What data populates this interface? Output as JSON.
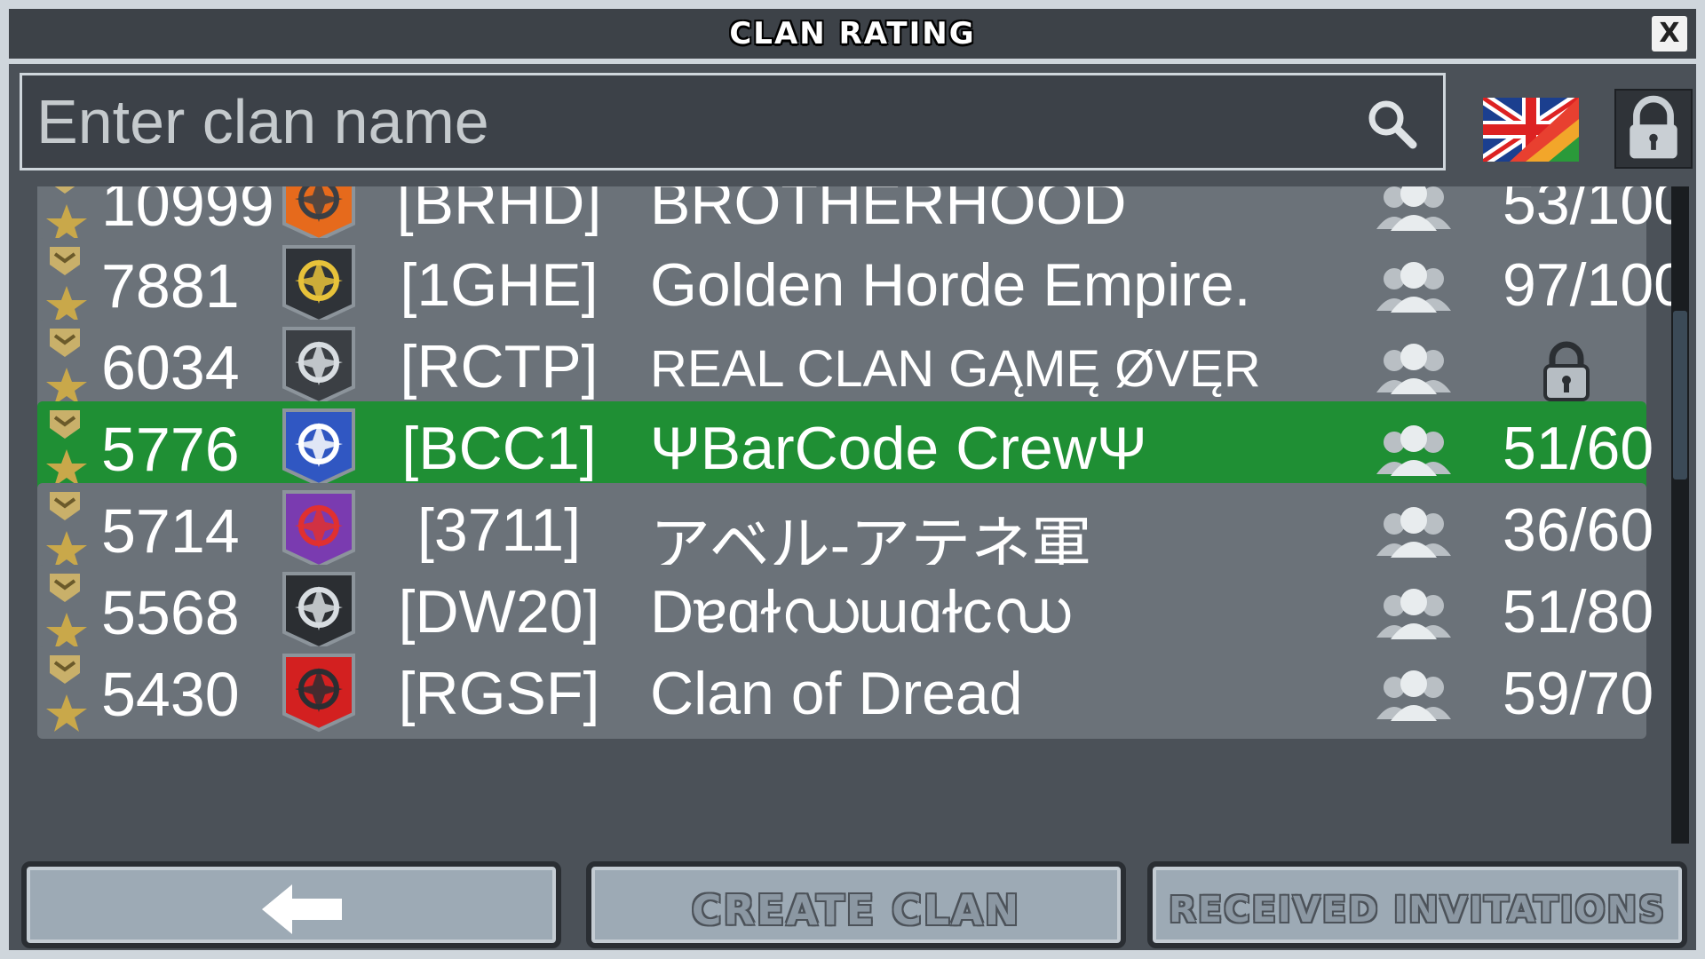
{
  "window": {
    "title": "CLAN RATING",
    "close_label": "X"
  },
  "search": {
    "placeholder": "Enter clan name",
    "value": ""
  },
  "language_flag": "uk-flag-icon",
  "clans": [
    {
      "rank": "10999",
      "tag": "[BRHD]",
      "name": "BROTHERHOOD",
      "members": "53/100",
      "selected": false
    },
    {
      "rank": "7881",
      "tag": "[1GHE]",
      "name": "Golden Horde Empire.",
      "members": "97/100",
      "selected": false
    },
    {
      "rank": "6034",
      "tag": "[RCTP]",
      "name": "REAL CLAN GĄMĘ ØVĘR",
      "members": "",
      "locked": true,
      "selected": false
    },
    {
      "rank": "5776",
      "tag": "[BCC1]",
      "name": "ΨBarCode CrewΨ",
      "members": "51/60",
      "selected": true
    },
    {
      "rank": "5714",
      "tag": "[3711]",
      "name": "アベル-アテネ軍",
      "members": "36/60",
      "selected": false
    },
    {
      "rank": "5568",
      "tag": "[DW20]",
      "name": "Dɐɑɫഡɯɑɫϲഡ",
      "members": "51/80",
      "selected": false
    },
    {
      "rank": "5430",
      "tag": "[RGSF]",
      "name": "Clan of Dread",
      "members": "59/70",
      "selected": false
    }
  ],
  "buttons": {
    "back": "back-arrow-icon",
    "create_clan": "CREATE CLAN",
    "received_invitations": "RECEIVED INVITATIONS"
  },
  "colors": {
    "selected_row": "#1f8f34",
    "row": "#6b7279",
    "background": "#4b5158"
  }
}
